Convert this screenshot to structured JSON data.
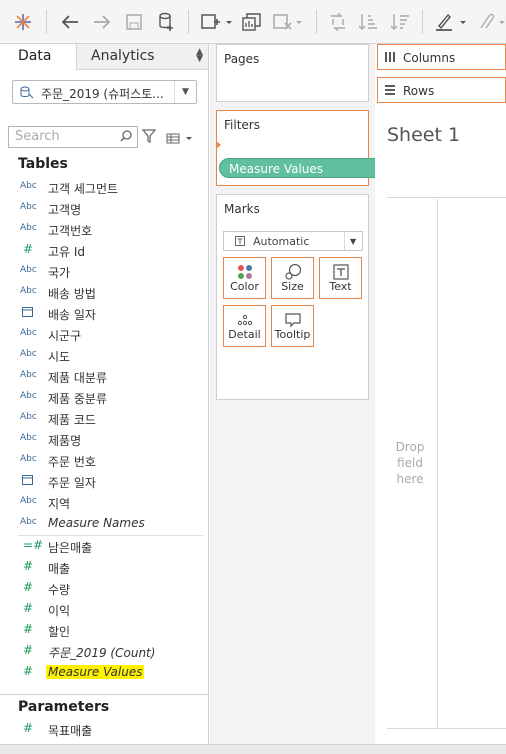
{
  "toolbar": {
    "icons": [
      "tableau-logo-icon",
      "undo-icon",
      "redo-icon",
      "save-icon",
      "new-datasource-icon",
      "new-worksheet-icon",
      "duplicate-icon",
      "clear-icon",
      "swap-icon",
      "sort-ascending-icon",
      "sort-descending-icon",
      "highlight-icon",
      "attach-icon"
    ]
  },
  "tabs": {
    "data": "Data",
    "analytics": "Analytics"
  },
  "datasource": {
    "name": "주문_2019 (슈퍼스토..."
  },
  "search": {
    "placeholder": "Search"
  },
  "sections": {
    "tables": "Tables",
    "parameters": "Parameters"
  },
  "dimensions": [
    {
      "type": "Abc",
      "name": "고객 세그먼트"
    },
    {
      "type": "Abc",
      "name": "고객명"
    },
    {
      "type": "Abc",
      "name": "고객번호"
    },
    {
      "type": "#",
      "name": "고유 Id"
    },
    {
      "type": "Abc",
      "name": "국가"
    },
    {
      "type": "Abc",
      "name": "배송 방법"
    },
    {
      "type": "cal",
      "name": "배송 일자"
    },
    {
      "type": "Abc",
      "name": "시군구"
    },
    {
      "type": "Abc",
      "name": "시도"
    },
    {
      "type": "Abc",
      "name": "제품 대분류"
    },
    {
      "type": "Abc",
      "name": "제품 중분류"
    },
    {
      "type": "Abc",
      "name": "제품 코드"
    },
    {
      "type": "Abc",
      "name": "제품명"
    },
    {
      "type": "Abc",
      "name": "주문 번호"
    },
    {
      "type": "cal",
      "name": "주문 일자"
    },
    {
      "type": "Abc",
      "name": "지역"
    },
    {
      "type": "Abc",
      "name": "Measure Names"
    }
  ],
  "measures": [
    {
      "type": "=#",
      "name": "남은매출"
    },
    {
      "type": "#",
      "name": "매출"
    },
    {
      "type": "#",
      "name": "수량"
    },
    {
      "type": "#",
      "name": "이익"
    },
    {
      "type": "#",
      "name": "할인"
    },
    {
      "type": "#",
      "name": "주문_2019 (Count)"
    },
    {
      "type": "#",
      "name": "Measure Values"
    }
  ],
  "parameters": [
    {
      "type": "#",
      "name": "목표매출"
    }
  ],
  "cards": {
    "pages": "Pages",
    "filters": "Filters",
    "filter_pill": "Measure Values",
    "marks": "Marks",
    "mark_type": "Automatic",
    "mark_buttons": [
      "Color",
      "Size",
      "Text",
      "Detail",
      "Tooltip"
    ]
  },
  "shelves": {
    "columns": "Columns",
    "rows": "Rows"
  },
  "sheet": {
    "title": "Sheet 1",
    "drop_hint": [
      "Drop",
      "field",
      "here"
    ]
  },
  "colors": {
    "accent": "#e8864a",
    "pill": "#5fbfa0",
    "highlight": "#fff200"
  }
}
